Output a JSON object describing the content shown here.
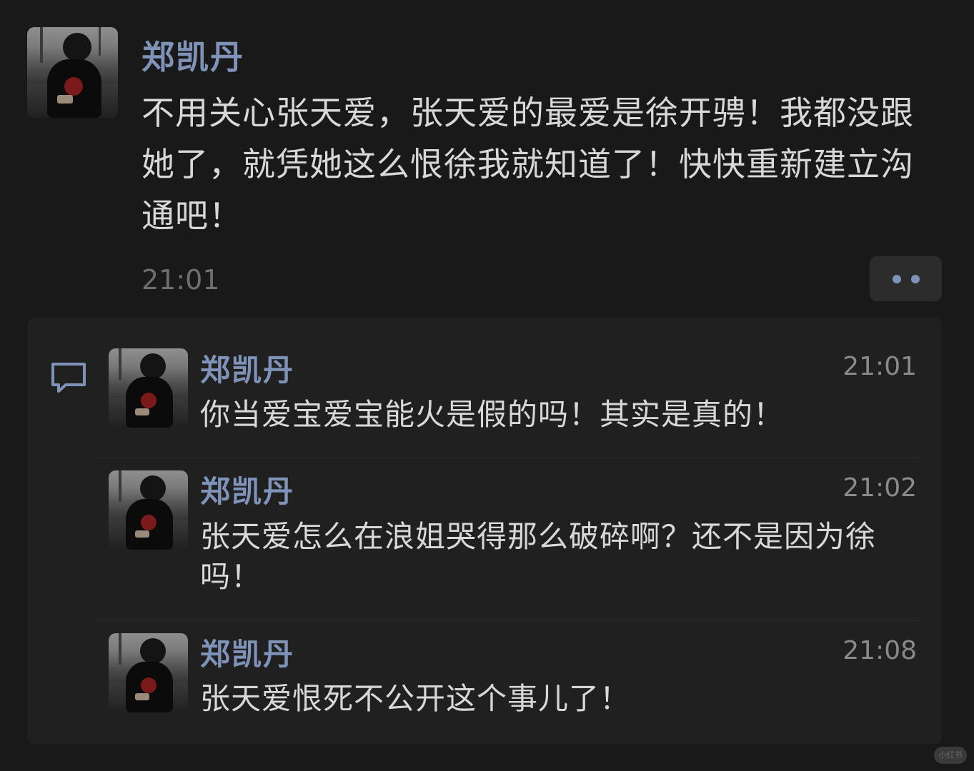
{
  "post": {
    "author": "郑凯丹",
    "text": "不用关心张天爱，张天爱的最爱是徐开骋！我都没跟她了，就凭她这么恨徐我就知道了！快快重新建立沟通吧！",
    "time": "21:01",
    "more_icon": "more-dots-icon",
    "comment_icon": "comment-bubble-icon"
  },
  "replies": [
    {
      "author": "郑凯丹",
      "time": "21:01",
      "text": "你当爱宝爱宝能火是假的吗！其实是真的！"
    },
    {
      "author": "郑凯丹",
      "time": "21:02",
      "text": "张天爱怎么在浪姐哭得那么破碎啊？还不是因为徐吗！"
    },
    {
      "author": "郑凯丹",
      "time": "21:08",
      "text": "张天爱恨死不公开这个事儿了！"
    }
  ],
  "watermark": "小红书",
  "colors": {
    "background": "#191919",
    "panel": "#202020",
    "name": "#7f93b8",
    "text": "#d8d8d8",
    "time": "#6f6f6f"
  }
}
